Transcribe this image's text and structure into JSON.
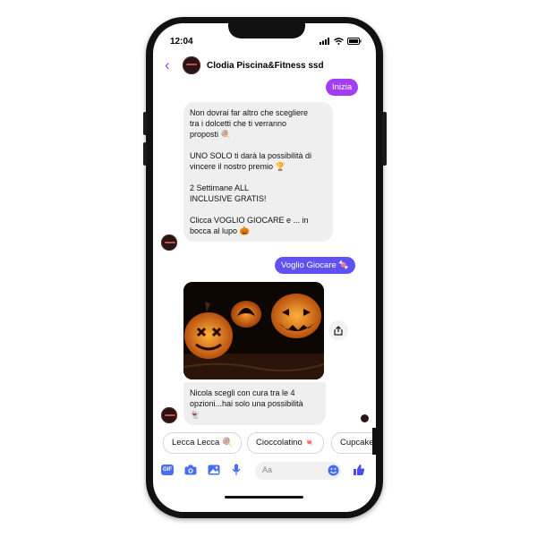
{
  "status_bar": {
    "time": "12:04"
  },
  "header": {
    "title": "Clodia Piscina&Fitness ssd"
  },
  "messages": {
    "inizia": "Inizia",
    "intro": "Non dovrai far altro che scegliere\ntra i dolcetti che ti verranno\nproposti 🍭\n\nUNO SOLO ti darà la possibilità di\nvincere il nostro premio 🏆\n\n2 Settimane ALL\nINCLUSIVE GRATIS!\n\nClicca VOGLIO GIOCARE e ... in\nbocca al lupo 🎃",
    "voglio_giocare": "Voglio Giocare 🍬",
    "choose": "Nicola scegli con cura tra le 4\nopzioni...hai solo una possibilità\n👻"
  },
  "quick_replies": [
    "Lecca Lecca 🍭",
    "Cioccolatino 🍬",
    "Cupcake"
  ],
  "composer": {
    "placeholder": "Aa",
    "gif_label": "GIF"
  },
  "colors": {
    "accent": "#a23df2",
    "bubble_out_purple": "#a13ef4",
    "bubble_out_blue": "#6151f3",
    "like": "#4a4df2"
  }
}
